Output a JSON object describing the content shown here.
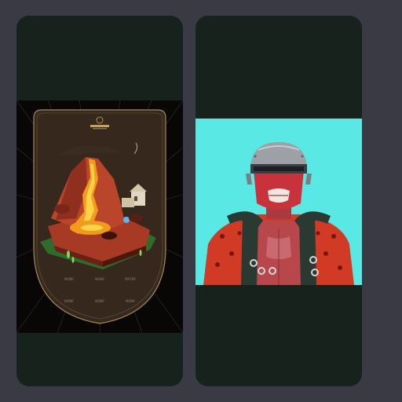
{
  "gallery": {
    "cards": [
      {
        "kind": "volcano-land-card",
        "stats": [
          {
            "label": "NONE"
          },
          {
            "label": "NONE"
          },
          {
            "label": "WATER"
          },
          {
            "label": "NONE"
          },
          {
            "label": "NONE"
          },
          {
            "label": "NONE"
          }
        ]
      },
      {
        "kind": "robo-helmet-character-card"
      }
    ]
  },
  "colors": {
    "page_background": "#393a44",
    "card_background": "#17221d",
    "right_art_background": "#5ae8e4",
    "left_art_background": "#090706",
    "lava": "#f29a1b",
    "rock": "#a63a24",
    "grass": "#2f6b2a",
    "slime": "#7ed957",
    "frame": "#a38a5a",
    "helmet": "#9da1a6",
    "skin": "#c8323c",
    "suit_red": "#d13a25",
    "vest": "#2a3a33"
  }
}
